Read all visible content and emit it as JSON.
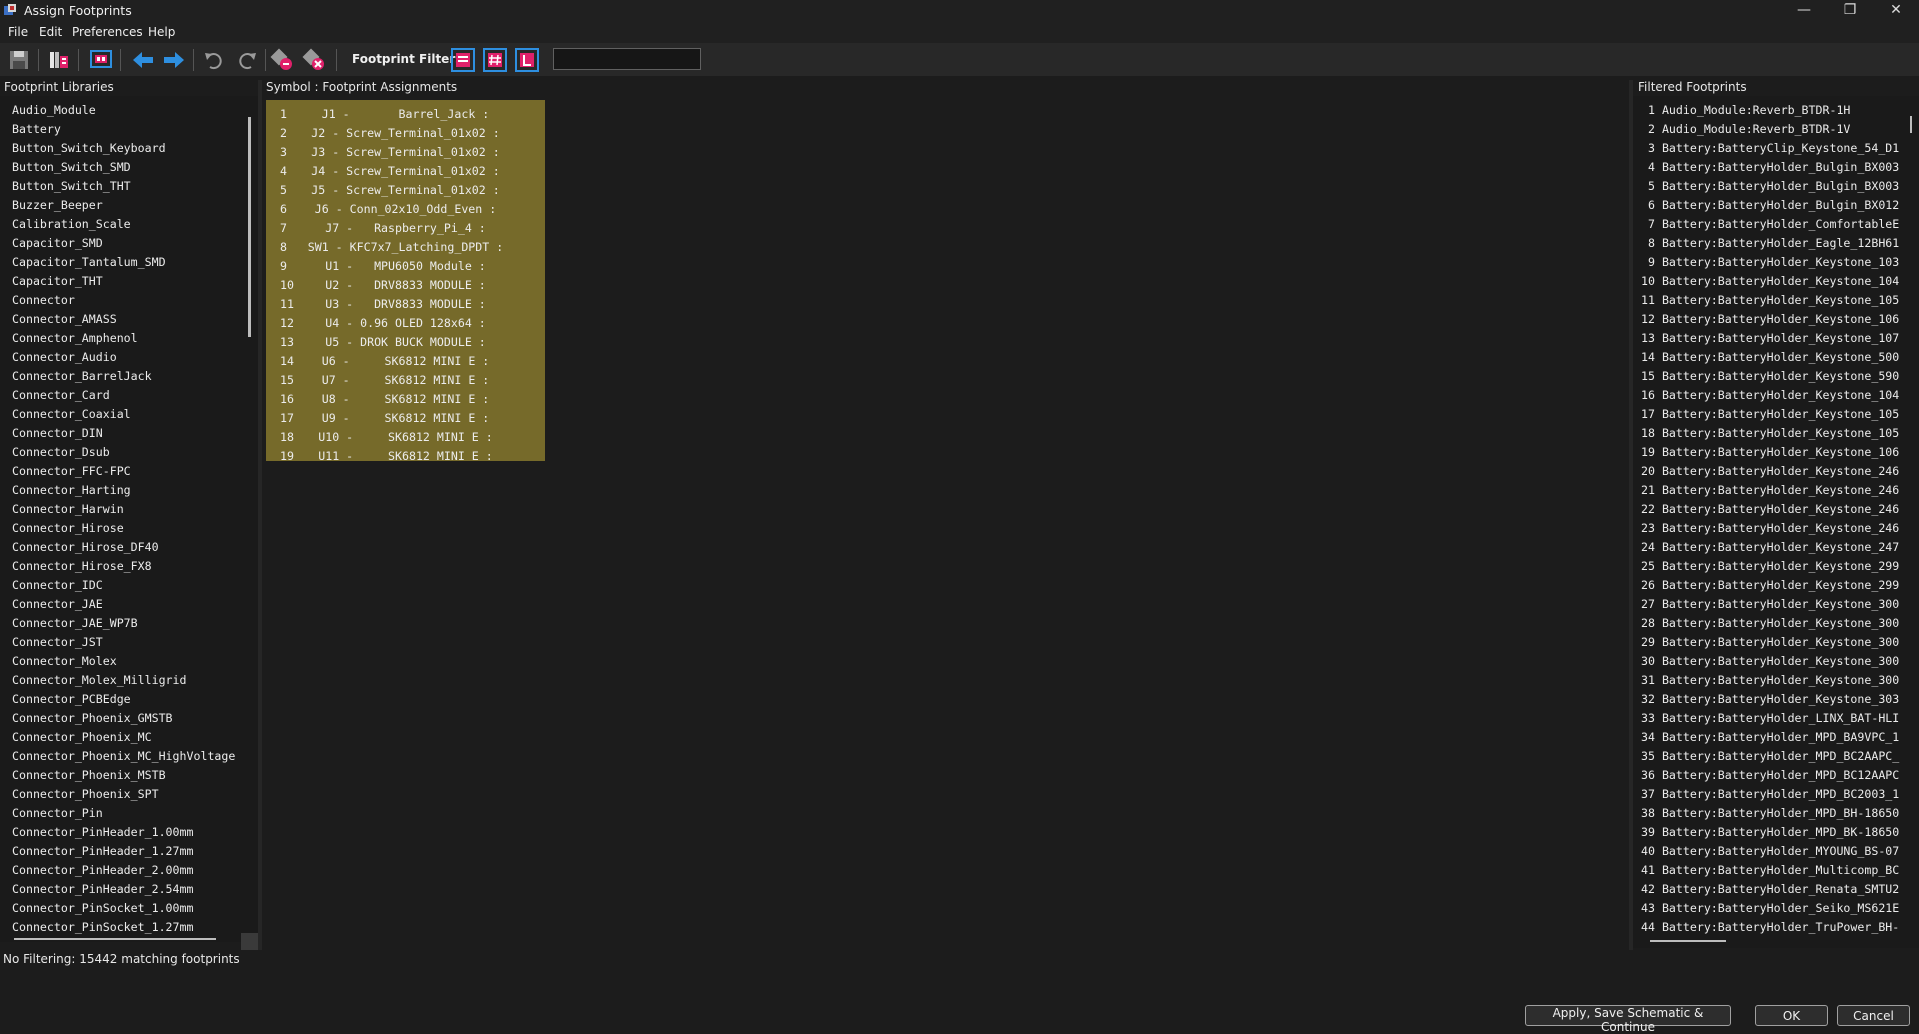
{
  "window": {
    "title": "Assign Footprints"
  },
  "menu": [
    "File",
    "Edit",
    "Preferences",
    "Help"
  ],
  "toolbar": {
    "icons": [
      "save-icon",
      "library-table-icon",
      "footprint-viewer-icon",
      "previous-unassigned-icon",
      "next-unassigned-icon",
      "undo-icon",
      "redo-icon",
      "auto-assign-icon",
      "delete-all-assignments-icon",
      "filter-keywords-icon",
      "filter-pin-count-icon",
      "filter-library-icon"
    ],
    "filters_label": "Footprint Filters:",
    "filter_search_value": ""
  },
  "panels": {
    "libraries_title": "Footprint Libraries",
    "assignments_title": "Symbol : Footprint Assignments",
    "filtered_title": "Filtered Footprints"
  },
  "libraries": [
    "Audio_Module",
    "Battery",
    "Button_Switch_Keyboard",
    "Button_Switch_SMD",
    "Button_Switch_THT",
    "Buzzer_Beeper",
    "Calibration_Scale",
    "Capacitor_SMD",
    "Capacitor_Tantalum_SMD",
    "Capacitor_THT",
    "Connector",
    "Connector_AMASS",
    "Connector_Amphenol",
    "Connector_Audio",
    "Connector_BarrelJack",
    "Connector_Card",
    "Connector_Coaxial",
    "Connector_DIN",
    "Connector_Dsub",
    "Connector_FFC-FPC",
    "Connector_Harting",
    "Connector_Harwin",
    "Connector_Hirose",
    "Connector_Hirose_DF40",
    "Connector_Hirose_FX8",
    "Connector_IDC",
    "Connector_JAE",
    "Connector_JAE_WP7B",
    "Connector_JST",
    "Connector_Molex",
    "Connector_Molex_Milligrid",
    "Connector_PCBEdge",
    "Connector_Phoenix_GMSTB",
    "Connector_Phoenix_MC",
    "Connector_Phoenix_MC_HighVoltage",
    "Connector_Phoenix_MSTB",
    "Connector_Phoenix_SPT",
    "Connector_Pin",
    "Connector_PinHeader_1.00mm",
    "Connector_PinHeader_1.27mm",
    "Connector_PinHeader_2.00mm",
    "Connector_PinHeader_2.54mm",
    "Connector_PinSocket_1.00mm",
    "Connector_PinSocket_1.27mm"
  ],
  "assignments": [
    {
      "num": "1",
      "text": "J1 -       Barrel_Jack :"
    },
    {
      "num": "2",
      "text": "J2 - Screw_Terminal_01x02 :"
    },
    {
      "num": "3",
      "text": "J3 - Screw_Terminal_01x02 :"
    },
    {
      "num": "4",
      "text": "J4 - Screw_Terminal_01x02 :"
    },
    {
      "num": "5",
      "text": "J5 - Screw_Terminal_01x02 :"
    },
    {
      "num": "6",
      "text": "J6 - Conn_02x10_Odd_Even :"
    },
    {
      "num": "7",
      "text": "J7 -   Raspberry_Pi_4 :"
    },
    {
      "num": "8",
      "text": "SW1 - KFC7x7_Latching_DPDT :"
    },
    {
      "num": "9",
      "text": "U1 -   MPU6050 Module :"
    },
    {
      "num": "10",
      "text": "U2 -   DRV8833 MODULE :"
    },
    {
      "num": "11",
      "text": "U3 -   DRV8833 MODULE :"
    },
    {
      "num": "12",
      "text": "U4 - 0.96 OLED 128x64 :"
    },
    {
      "num": "13",
      "text": "U5 - DROK BUCK MODULE :"
    },
    {
      "num": "14",
      "text": "U6 -     SK6812 MINI E :"
    },
    {
      "num": "15",
      "text": "U7 -     SK6812 MINI E :"
    },
    {
      "num": "16",
      "text": "U8 -     SK6812 MINI E :"
    },
    {
      "num": "17",
      "text": "U9 -     SK6812 MINI E :"
    },
    {
      "num": "18",
      "text": "U10 -     SK6812 MINI E :"
    },
    {
      "num": "19",
      "text": "U11 -     SK6812 MINI E :"
    }
  ],
  "filtered_footprints": [
    " 1 Audio_Module:Reverb_BTDR-1H",
    " 2 Audio_Module:Reverb_BTDR-1V",
    " 3 Battery:BatteryClip_Keystone_54_D1",
    " 4 Battery:BatteryHolder_Bulgin_BX003",
    " 5 Battery:BatteryHolder_Bulgin_BX003",
    " 6 Battery:BatteryHolder_Bulgin_BX012",
    " 7 Battery:BatteryHolder_ComfortableE",
    " 8 Battery:BatteryHolder_Eagle_12BH61",
    " 9 Battery:BatteryHolder_Keystone_103",
    "10 Battery:BatteryHolder_Keystone_104",
    "11 Battery:BatteryHolder_Keystone_105",
    "12 Battery:BatteryHolder_Keystone_106",
    "13 Battery:BatteryHolder_Keystone_107",
    "14 Battery:BatteryHolder_Keystone_500",
    "15 Battery:BatteryHolder_Keystone_590",
    "16 Battery:BatteryHolder_Keystone_104",
    "17 Battery:BatteryHolder_Keystone_105",
    "18 Battery:BatteryHolder_Keystone_105",
    "19 Battery:BatteryHolder_Keystone_106",
    "20 Battery:BatteryHolder_Keystone_246",
    "21 Battery:BatteryHolder_Keystone_246",
    "22 Battery:BatteryHolder_Keystone_246",
    "23 Battery:BatteryHolder_Keystone_246",
    "24 Battery:BatteryHolder_Keystone_247",
    "25 Battery:BatteryHolder_Keystone_299",
    "26 Battery:BatteryHolder_Keystone_299",
    "27 Battery:BatteryHolder_Keystone_300",
    "28 Battery:BatteryHolder_Keystone_300",
    "29 Battery:BatteryHolder_Keystone_300",
    "30 Battery:BatteryHolder_Keystone_300",
    "31 Battery:BatteryHolder_Keystone_300",
    "32 Battery:BatteryHolder_Keystone_303",
    "33 Battery:BatteryHolder_LINX_BAT-HLI",
    "34 Battery:BatteryHolder_MPD_BA9VPC_1",
    "35 Battery:BatteryHolder_MPD_BC2AAPC_",
    "36 Battery:BatteryHolder_MPD_BC12AAPC",
    "37 Battery:BatteryHolder_MPD_BC2003_1",
    "38 Battery:BatteryHolder_MPD_BH-18650",
    "39 Battery:BatteryHolder_MPD_BK-18650",
    "40 Battery:BatteryHolder_MYOUNG_BS-07",
    "41 Battery:BatteryHolder_Multicomp_BC",
    "42 Battery:BatteryHolder_Renata_SMTU2",
    "43 Battery:BatteryHolder_Seiko_MS621E",
    "44 Battery:BatteryHolder_TruPower_BH-"
  ],
  "status": "No Filtering: 15442 matching footprints",
  "buttons": {
    "apply": "Apply, Save Schematic & Continue",
    "ok": "OK",
    "cancel": "Cancel"
  },
  "colors": {
    "background": "#1c1c1c",
    "assignment_highlight": "#766a2a",
    "accent_blue": "#2e8fe0",
    "filter_icon_pink": "#e0206a"
  }
}
